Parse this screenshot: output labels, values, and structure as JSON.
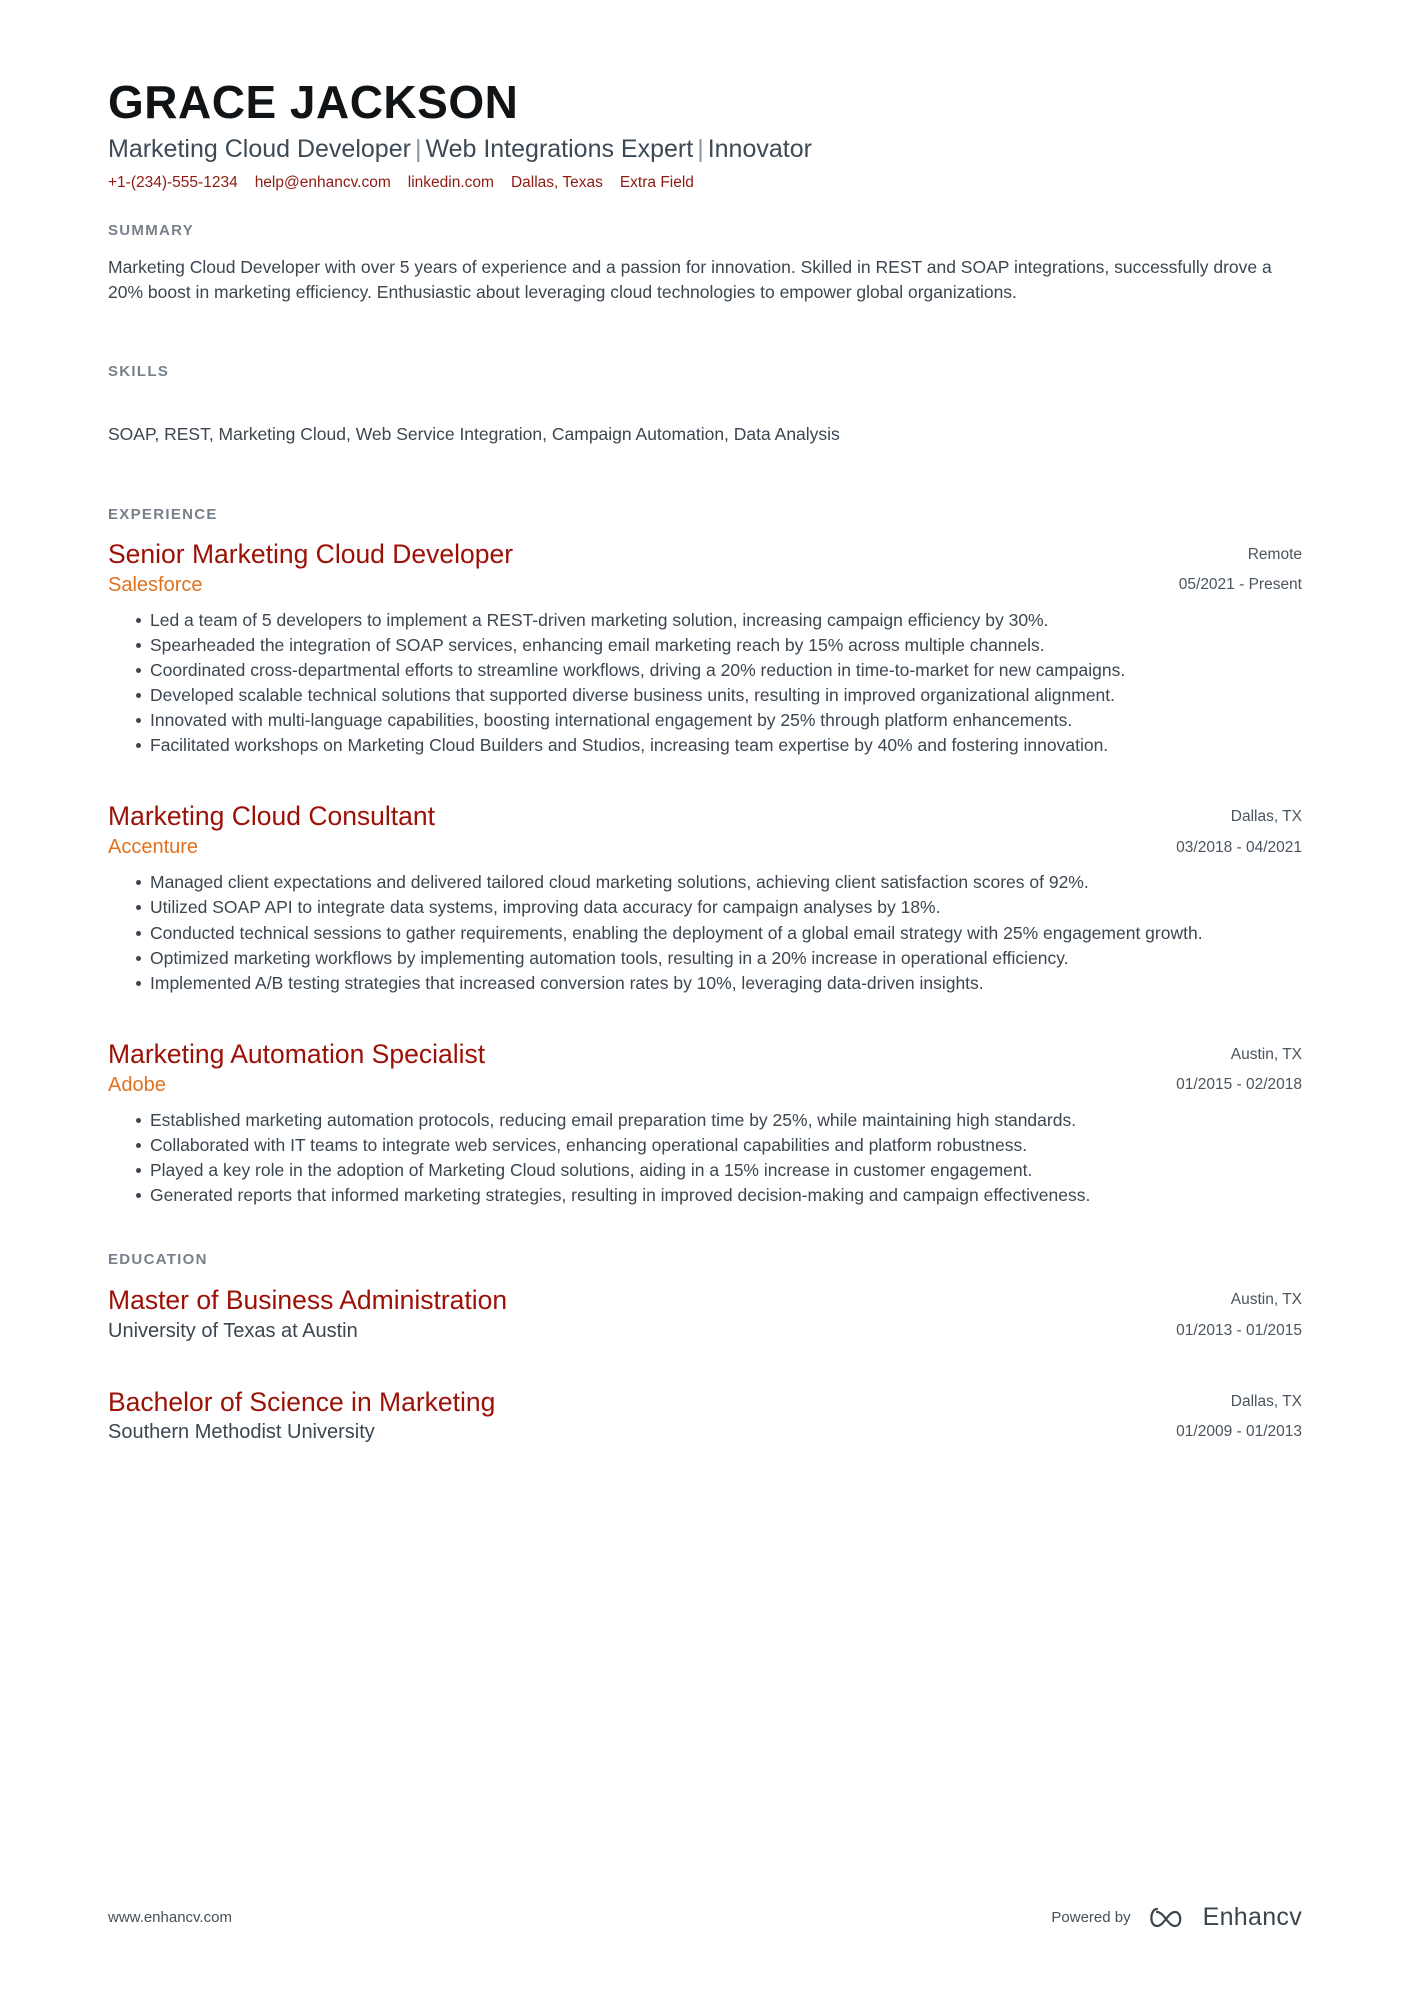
{
  "header": {
    "name": "GRACE JACKSON",
    "headline_parts": [
      "Marketing Cloud Developer",
      "Web Integrations Expert",
      "Innovator"
    ],
    "headline_separator": "|",
    "contacts": [
      {
        "name": "phone",
        "value": "+1-(234)-555-1234"
      },
      {
        "name": "email",
        "value": "help@enhancv.com"
      },
      {
        "name": "linkedin",
        "value": "linkedin.com"
      },
      {
        "name": "location",
        "value": "Dallas, Texas"
      },
      {
        "name": "extra",
        "value": "Extra Field"
      }
    ],
    "accent_color": "#8f1a12"
  },
  "sections": {
    "summary": {
      "title": "SUMMARY",
      "text": "Marketing Cloud Developer with over 5 years of experience and a passion for innovation. Skilled in REST and SOAP integrations, successfully drove a 20% boost in marketing efficiency. Enthusiastic about leveraging cloud technologies to empower global organizations."
    },
    "skills": {
      "title": "SKILLS",
      "text": "SOAP, REST, Marketing Cloud, Web Service Integration, Campaign Automation, Data Analysis"
    },
    "experience": {
      "title": "EXPERIENCE",
      "entries": [
        {
          "title": "Senior Marketing Cloud Developer",
          "organization": "Salesforce",
          "location": "Remote",
          "date": "05/2021 - Present",
          "bullets": [
            "Led a team of 5 developers to implement a REST-driven marketing solution, increasing campaign efficiency by 30%.",
            "Spearheaded the integration of SOAP services, enhancing email marketing reach by 15% across multiple channels.",
            "Coordinated cross-departmental efforts to streamline workflows, driving a 20% reduction in time-to-market for new campaigns.",
            "Developed scalable technical solutions that supported diverse business units, resulting in improved organizational alignment.",
            "Innovated with multi-language capabilities, boosting international engagement by 25% through platform enhancements.",
            "Facilitated workshops on Marketing Cloud Builders and Studios, increasing team expertise by 40% and fostering innovation."
          ]
        },
        {
          "title": "Marketing Cloud Consultant",
          "organization": "Accenture",
          "location": "Dallas, TX",
          "date": "03/2018 - 04/2021",
          "bullets": [
            "Managed client expectations and delivered tailored cloud marketing solutions, achieving client satisfaction scores of 92%.",
            "Utilized SOAP API to integrate data systems, improving data accuracy for campaign analyses by 18%.",
            "Conducted technical sessions to gather requirements, enabling the deployment of a global email strategy with 25% engagement growth.",
            "Optimized marketing workflows by implementing automation tools, resulting in a 20% increase in operational efficiency.",
            "Implemented A/B testing strategies that increased conversion rates by 10%, leveraging data-driven insights."
          ]
        },
        {
          "title": "Marketing Automation Specialist",
          "organization": "Adobe",
          "location": "Austin, TX",
          "date": "01/2015 - 02/2018",
          "bullets": [
            "Established marketing automation protocols, reducing email preparation time by 25%, while maintaining high standards.",
            "Collaborated with IT teams to integrate web services, enhancing operational capabilities and platform robustness.",
            "Played a key role in the adoption of Marketing Cloud solutions, aiding in a 15% increase in customer engagement.",
            "Generated reports that informed marketing strategies, resulting in improved decision-making and campaign effectiveness."
          ]
        }
      ]
    },
    "education": {
      "title": "EDUCATION",
      "entries": [
        {
          "degree": "Master of Business Administration",
          "school": "University of Texas at Austin",
          "location": "Austin, TX",
          "date": "01/2013 - 01/2015"
        },
        {
          "degree": "Bachelor of Science in Marketing",
          "school": "Southern Methodist University",
          "location": "Dallas, TX",
          "date": "01/2009 - 01/2013"
        }
      ]
    }
  },
  "footer": {
    "url": "www.enhancv.com",
    "powered_by": "Powered by",
    "brand": "Enhancv"
  },
  "colors": {
    "title_red": "#9c1006",
    "org_orange": "#e2711d",
    "section_gray": "#77808a",
    "body": "#3c4650"
  }
}
